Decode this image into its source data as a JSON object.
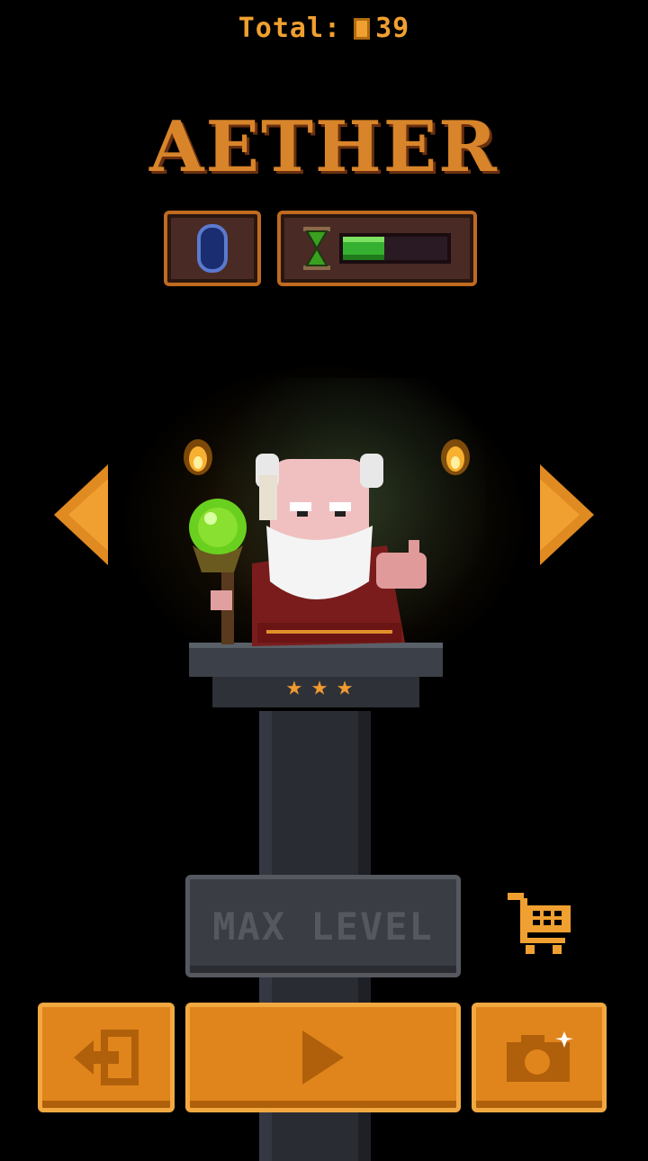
{
  "header": {
    "total_label": "Total:",
    "total_value": "39"
  },
  "title": "AETHER",
  "status": {
    "gem_icon": "blue-gem-icon",
    "hourglass_icon": "hourglass-icon",
    "timer_progress": 0.4
  },
  "character": {
    "stars": 3,
    "star_glyph": "★"
  },
  "upgrade": {
    "label": "MAX LEVEL"
  },
  "icons": {
    "prev": "arrow-left-icon",
    "next": "arrow-right-icon",
    "cart": "cart-icon",
    "exit": "exit-icon",
    "play": "play-icon",
    "camera": "camera-icon"
  },
  "colors": {
    "accent": "#e0841c",
    "gold": "#f0a030",
    "disabled": "#55595f"
  }
}
